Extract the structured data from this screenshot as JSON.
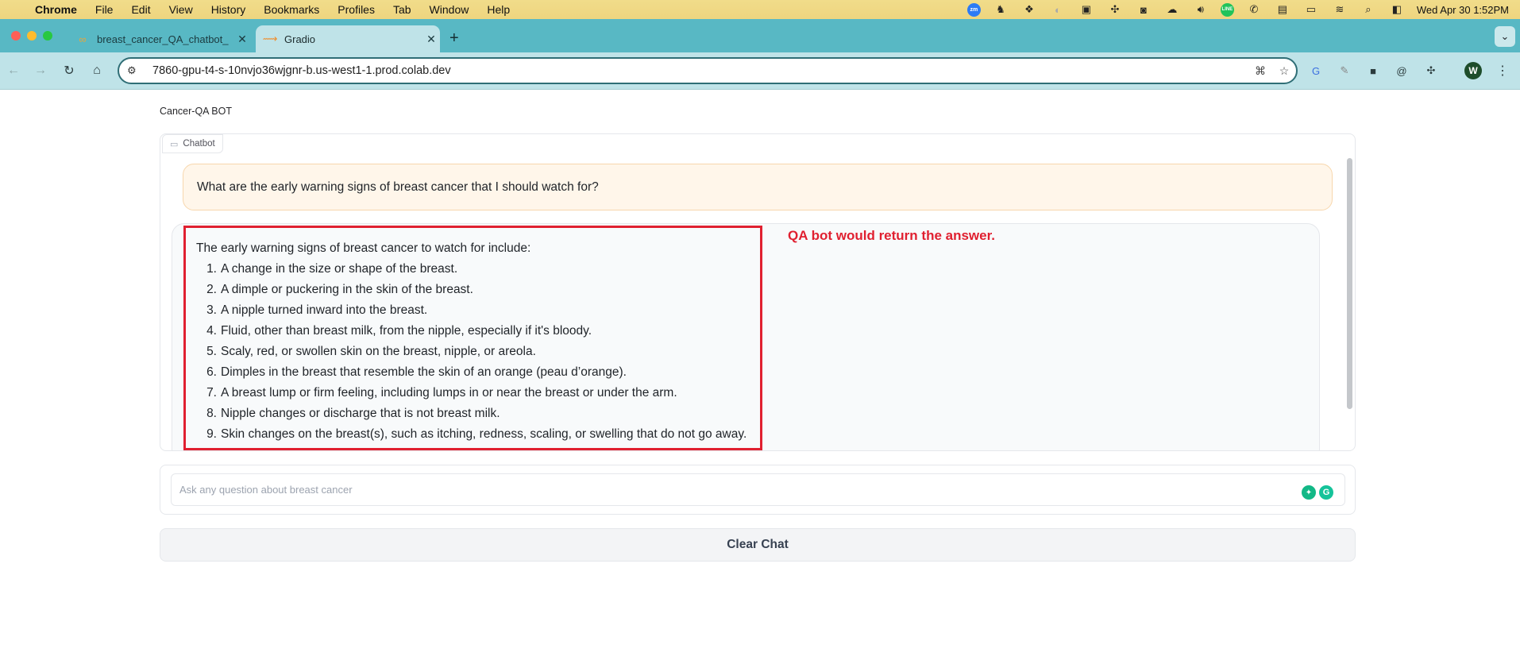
{
  "menubar": {
    "items": [
      "Chrome",
      "File",
      "Edit",
      "View",
      "History",
      "Bookmarks",
      "Profiles",
      "Tab",
      "Window",
      "Help"
    ],
    "clock": "Wed Apr 30  1:52PM"
  },
  "tabs": [
    {
      "title": "breast_cancer_QA_chatbot_",
      "active": false
    },
    {
      "title": "Gradio",
      "active": true
    }
  ],
  "address_bar": {
    "url": "7860-gpu-t4-s-10nvjo36wjgnr-b.us-west1-1.prod.colab.dev"
  },
  "profile": {
    "initial": "W"
  },
  "app": {
    "title": "Cancer-QA BOT",
    "chatbot_label": "Chatbot",
    "user_message": "What are the early warning signs of breast cancer that I should watch for?",
    "bot_intro": "The early warning signs of breast cancer to watch for include:",
    "bot_items": [
      {
        "num": "1.",
        "text": "A change in the size or shape of the breast."
      },
      {
        "num": "2.",
        "text": "A dimple or puckering in the skin of the breast."
      },
      {
        "num": "3.",
        "text": "A nipple turned inward into the breast."
      },
      {
        "num": "4.",
        "text": "Fluid, other than breast milk, from the nipple, especially if it's bloody."
      },
      {
        "num": "5.",
        "text": "Scaly, red, or swollen skin on the breast, nipple, or areola."
      },
      {
        "num": "6.",
        "text": "Dimples in the breast that resemble the skin of an orange (peau d’orange)."
      },
      {
        "num": "7.",
        "text": "A breast lump or firm feeling, including lumps in or near the breast or under the arm."
      },
      {
        "num": "8.",
        "text": "Nipple changes or discharge that is not breast milk."
      },
      {
        "num": "9.",
        "text": "Skin changes on the breast(s), such as itching, redness, scaling, or swelling that do not go away."
      }
    ],
    "annotation": "QA bot would return the answer.",
    "input_placeholder": "Ask any question about breast cancer",
    "clear_button": "Clear Chat"
  },
  "colors": {
    "annotation": "#e02030",
    "tab_strip": "#58b8c4",
    "toolbar": "#bfe3e8"
  }
}
